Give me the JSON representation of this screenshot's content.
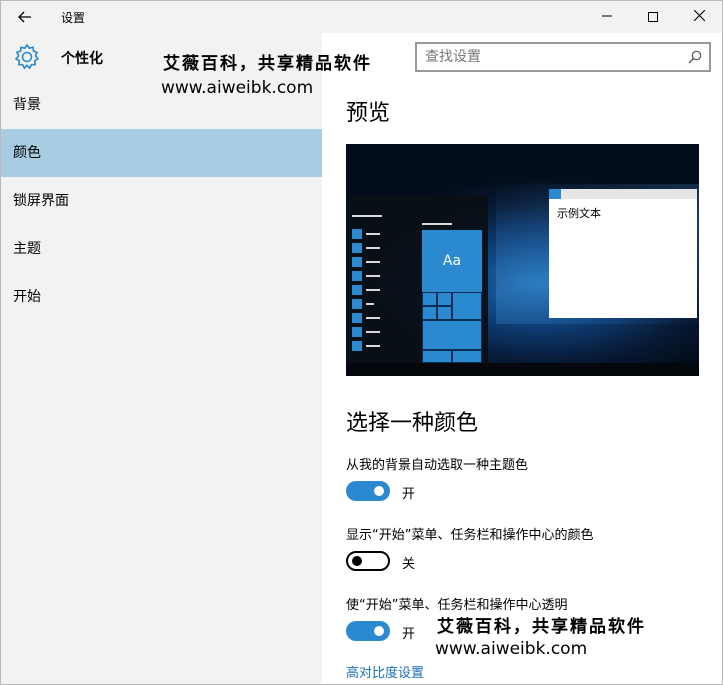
{
  "window": {
    "title": "设置",
    "back_icon": "arrow-left-icon",
    "controls": {
      "minimize": "—",
      "close": "✕"
    }
  },
  "sidebar": {
    "section_icon": "gear-icon",
    "section_title": "个性化",
    "items": [
      {
        "label": "背景",
        "selected": false
      },
      {
        "label": "颜色",
        "selected": true
      },
      {
        "label": "锁屏界面",
        "selected": false
      },
      {
        "label": "主题",
        "selected": false
      },
      {
        "label": "开始",
        "selected": false
      }
    ]
  },
  "search": {
    "placeholder": "查找设置",
    "icon": "search-icon"
  },
  "main": {
    "preview_heading": "预览",
    "preview": {
      "tile_label": "Aa",
      "sample_text": "示例文本"
    },
    "color_heading": "选择一种颜色",
    "options": [
      {
        "label": "从我的背景自动选取一种主题色",
        "on": true,
        "state": "开"
      },
      {
        "label": "显示“开始”菜单、任务栏和操作中心的颜色",
        "on": false,
        "state": "关"
      },
      {
        "label": "使“开始”菜单、任务栏和操作中心透明",
        "on": true,
        "state": "开"
      }
    ],
    "high_contrast_link": "高对比度设置"
  },
  "watermarks": [
    {
      "cn": "艾薇百科，共享精品软件",
      "url": "www.aiweibk.com"
    },
    {
      "cn": "艾薇百科，共享精品软件",
      "url": "www.aiweibk.com"
    }
  ],
  "colors": {
    "accent": "#2b89cf",
    "selected_nav": "#a8cde3",
    "link": "#1a6fb8",
    "pane_bg": "#f2f2f2"
  }
}
